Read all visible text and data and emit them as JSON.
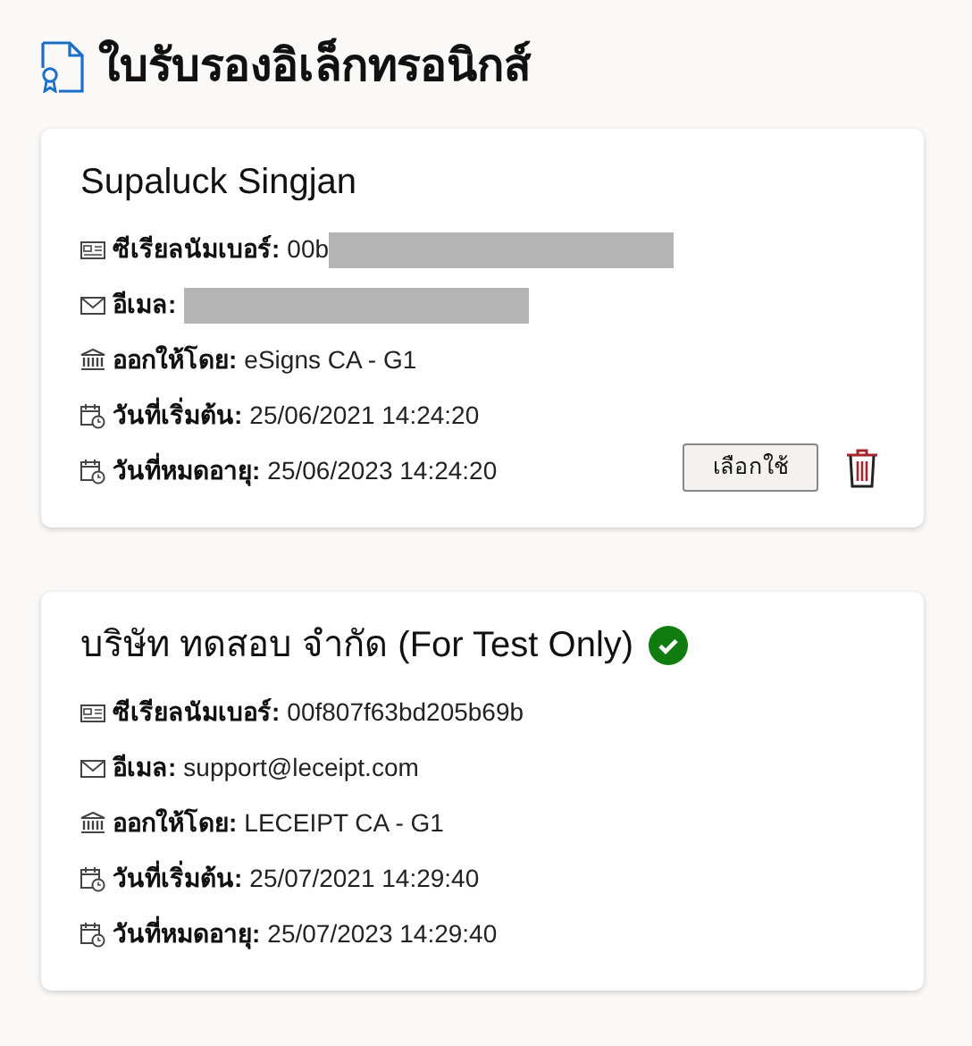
{
  "page": {
    "title": "ใบรับรองอิเล็กทรอนิกส์"
  },
  "certificates": [
    {
      "name": "Supaluck Singjan",
      "verified": false,
      "fields": [
        {
          "kind": "serial",
          "label": "ซีเรียลนัมเบอร์:",
          "value": "00b",
          "redacted": true
        },
        {
          "kind": "email",
          "label": "อีเมล:",
          "redacted": true
        },
        {
          "kind": "issuer",
          "label": "ออกให้โดย:",
          "value": "eSigns CA - G1",
          "redacted": false
        },
        {
          "kind": "start",
          "label": "วันที่เริ่มต้น:",
          "value": "25/06/2021 14:24:20",
          "redacted": false
        },
        {
          "kind": "expiry",
          "label": "วันที่หมดอายุ:",
          "value": "25/06/2023 14:24:20",
          "redacted": false
        }
      ],
      "actions": {
        "select_label": "เลือกใช้",
        "deletable": true
      }
    },
    {
      "name": "บริษัท ทดสอบ จำกัด (For Test Only)",
      "verified": true,
      "fields": [
        {
          "kind": "serial",
          "label": "ซีเรียลนัมเบอร์:",
          "value": "00f807f63bd205b69b",
          "redacted": false
        },
        {
          "kind": "email",
          "label": "อีเมล:",
          "value": "support@leceipt.com",
          "redacted": false
        },
        {
          "kind": "issuer",
          "label": "ออกให้โดย:",
          "value": "LECEIPT CA - G1",
          "redacted": false
        },
        {
          "kind": "start",
          "label": "วันที่เริ่มต้น:",
          "value": "25/07/2021 14:29:40",
          "redacted": false
        },
        {
          "kind": "expiry",
          "label": "วันที่หมดอายุ:",
          "value": "25/07/2023 14:29:40",
          "redacted": false
        }
      ]
    }
  ]
}
